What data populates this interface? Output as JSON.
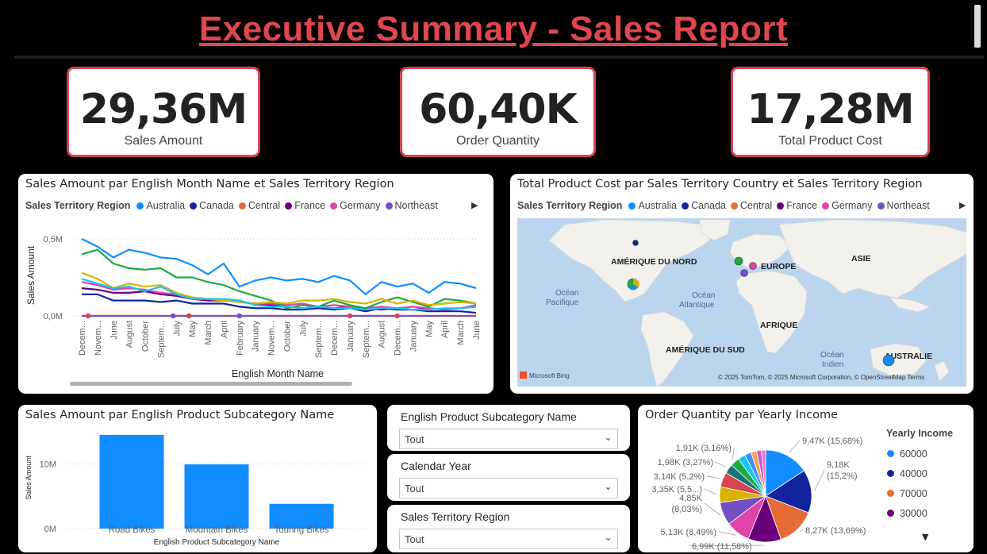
{
  "page": {
    "title": "Executive Summary - Sales Report "
  },
  "kpis": [
    {
      "value": "29,36M",
      "label": "Sales Amount"
    },
    {
      "value": "60,40K",
      "label": "Order Quantity"
    },
    {
      "value": "17,28M",
      "label": "Total Product Cost"
    }
  ],
  "line_panel": {
    "title": "Sales Amount par English Month Name et Sales Territory Region",
    "legend_title": "Sales Territory Region",
    "legend": [
      {
        "name": "Australia",
        "color": "#118dff"
      },
      {
        "name": "Canada",
        "color": "#12239e"
      },
      {
        "name": "Central",
        "color": "#e66c37"
      },
      {
        "name": "France",
        "color": "#6b007b"
      },
      {
        "name": "Germany",
        "color": "#e044a7"
      },
      {
        "name": "Northeast",
        "color": "#744ec2"
      }
    ],
    "legend_more": "▶"
  },
  "map_panel": {
    "title": "Total Product Cost par Sales Territory Country et Sales Territory Region",
    "legend_title": "Sales Territory Region",
    "legend": [
      {
        "name": "Australia",
        "color": "#118dff"
      },
      {
        "name": "Canada",
        "color": "#12239e"
      },
      {
        "name": "Central",
        "color": "#e66c37"
      },
      {
        "name": "France",
        "color": "#6b007b"
      },
      {
        "name": "Germany",
        "color": "#e044a7"
      },
      {
        "name": "Northeast",
        "color": "#744ec2"
      }
    ],
    "legend_more": "▶",
    "labels": {
      "na": "AMÉRIQUE DU NORD",
      "eu": "EUROPE",
      "asia": "ASIE",
      "africa": "AFRIQUE",
      "sa": "AMÉRIQUE DU SUD",
      "aus": "AUSTRALIE",
      "pac1": "Océan",
      "pac2": "Pacifique",
      "atl1": "Océan",
      "atl2": "Atlantique",
      "ind1": "Océan",
      "ind2": "Indien"
    },
    "attribution": "© 2025 TomTom, © 2025 Microsoft Corporation, © OpenStreetMap  Terms",
    "bing": "Microsoft Bing"
  },
  "bar_panel": {
    "title": "Sales Amount par English Product Subcategory Name"
  },
  "slicers": [
    {
      "title": "English Product Subcategory Name",
      "value": "Tout"
    },
    {
      "title": "Calendar Year",
      "value": "Tout"
    },
    {
      "title": "Sales Territory Region",
      "value": "Tout"
    }
  ],
  "pie_panel": {
    "title": "Order Quantity par Yearly Income",
    "legend_title": "Yearly Income",
    "legend": [
      {
        "name": "60000",
        "color": "#118dff"
      },
      {
        "name": "40000",
        "color": "#12239e"
      },
      {
        "name": "70000",
        "color": "#e66c37"
      },
      {
        "name": "30000",
        "color": "#6b007b"
      }
    ],
    "legend_more": "▼"
  },
  "chart_data": [
    {
      "type": "line",
      "xlabel": "English Month Name",
      "ylabel": "Sales Amount",
      "ytick_labels": [
        "0,0M",
        "0,5M"
      ],
      "ylim": [
        0,
        0.5
      ],
      "categories": [
        "Decem...",
        "Novem...",
        "June",
        "August",
        "October",
        "Septem...",
        "July",
        "May",
        "March",
        "April",
        "February",
        "January",
        "Novem...",
        "October",
        "July",
        "Septem...",
        "Decem...",
        "January",
        "Septem...",
        "August",
        "Decem...",
        "January",
        "May",
        "April",
        "March",
        "June"
      ],
      "series": [
        {
          "name": "Australia",
          "color": "#118dff",
          "values": [
            0.5,
            0.45,
            0.38,
            0.43,
            0.41,
            0.38,
            0.37,
            0.33,
            0.27,
            0.34,
            0.19,
            0.23,
            0.25,
            0.23,
            0.24,
            0.22,
            0.26,
            0.23,
            0.14,
            0.22,
            0.19,
            0.21,
            0.15,
            0.22,
            0.21,
            0.18
          ]
        },
        {
          "name": "Canada",
          "color": "#12239e",
          "values": [
            0.14,
            0.14,
            0.1,
            0.1,
            0.1,
            0.09,
            0.1,
            0.08,
            0.08,
            0.08,
            0.06,
            0.05,
            0.05,
            0.04,
            0.04,
            0.05,
            0.04,
            0.05,
            0.03,
            0.05,
            0.04,
            0.04,
            0.03,
            0.03,
            0.03,
            0.02
          ]
        },
        {
          "name": "Central",
          "color": "#e66c37",
          "values": [
            0.0,
            0.0,
            0.0,
            0.0,
            0.0,
            0.0,
            0.0,
            0.0,
            0.0,
            0.0,
            0.0,
            0.0,
            0.0,
            0.0,
            0.0,
            0.0,
            0.0,
            0.0,
            0.0,
            0.0,
            0.0,
            0.0,
            0.0,
            0.0,
            0.0,
            0.0
          ]
        },
        {
          "name": "France",
          "color": "#6b007b",
          "values": [
            0.18,
            0.17,
            0.15,
            0.15,
            0.16,
            0.14,
            0.13,
            0.11,
            0.1,
            0.1,
            0.09,
            0.08,
            0.07,
            0.06,
            0.05,
            0.06,
            0.05,
            0.06,
            0.05,
            0.04,
            0.05,
            0.04,
            0.05,
            0.04,
            0.05,
            0.06
          ]
        },
        {
          "name": "Germany",
          "color": "#e044a7",
          "values": [
            0.22,
            0.2,
            0.17,
            0.18,
            0.17,
            0.15,
            0.14,
            0.12,
            0.11,
            0.1,
            0.09,
            0.08,
            0.08,
            0.07,
            0.08,
            0.06,
            0.07,
            0.06,
            0.05,
            0.06,
            0.05,
            0.06,
            0.05,
            0.04,
            0.05,
            0.07
          ]
        },
        {
          "name": "Northeast",
          "color": "#744ec2",
          "values": [
            0.0,
            0.0,
            0.0,
            0.0,
            0.0,
            0.0,
            0.0,
            0.0,
            0.0,
            0.0,
            0.0,
            0.0,
            0.0,
            0.0,
            0.0,
            0.0,
            0.0,
            0.0,
            0.0,
            0.0,
            0.0,
            0.0,
            0.0,
            0.0,
            0.0,
            0.0
          ]
        },
        {
          "name": "",
          "color": "#1aab40",
          "values": [
            0.4,
            0.43,
            0.34,
            0.31,
            0.3,
            0.31,
            0.25,
            0.25,
            0.22,
            0.2,
            0.16,
            0.13,
            0.1,
            0.05,
            0.07,
            0.06,
            0.1,
            0.07,
            0.05,
            0.09,
            0.12,
            0.09,
            0.06,
            0.11,
            0.1,
            0.08
          ]
        },
        {
          "name": "",
          "color": "#d9b300",
          "values": [
            0.28,
            0.24,
            0.18,
            0.21,
            0.19,
            0.2,
            0.15,
            0.12,
            0.11,
            0.1,
            0.09,
            0.08,
            0.09,
            0.08,
            0.1,
            0.1,
            0.11,
            0.09,
            0.08,
            0.11,
            0.08,
            0.1,
            0.07,
            0.08,
            0.09,
            0.08
          ]
        },
        {
          "name": "",
          "color": "#15c6f4",
          "values": [
            0.24,
            0.21,
            0.18,
            0.19,
            0.16,
            0.19,
            0.14,
            0.11,
            0.11,
            0.11,
            0.1,
            0.07,
            0.06,
            0.06,
            0.05,
            0.06,
            0.05,
            0.05,
            0.04,
            0.05,
            0.05,
            0.04,
            0.04,
            0.05,
            0.05,
            0.06
          ]
        }
      ]
    },
    {
      "type": "bar",
      "xlabel": "English Product Subcategory Name",
      "ylabel": "Sales Amount",
      "ytick_labels": [
        "0M",
        "10M"
      ],
      "categories": [
        "Road Bikes",
        "Mountain Bikes",
        "Touring Bikes"
      ],
      "values": [
        14.52,
        9.95,
        3.84
      ],
      "ylim": [
        0,
        15
      ],
      "color": "#118dff"
    },
    {
      "type": "pie",
      "slices": [
        {
          "value": 9.47,
          "label": "9,47K (15,68%)",
          "color": "#118dff"
        },
        {
          "value": 9.18,
          "label": "9,18K (15,2%)",
          "color": "#12239e"
        },
        {
          "value": 8.27,
          "label": "8,27K (13,69%)",
          "color": "#e66c37"
        },
        {
          "value": 6.99,
          "label": "6,99K (11,58%)",
          "color": "#6b007b"
        },
        {
          "value": 5.13,
          "label": "5,13K (8,49%)",
          "color": "#e044a7"
        },
        {
          "value": 4.85,
          "label": "4,85K (8,03%)",
          "color": "#744ec2"
        },
        {
          "value": 3.35,
          "label": "3,35K (5,5...)",
          "color": "#d9b300"
        },
        {
          "value": 3.14,
          "label": "3,14K (5,2%)",
          "color": "#d64550"
        },
        {
          "value": 1.98,
          "label": "1,98K (3,27%)",
          "color": "#197278"
        },
        {
          "value": 1.91,
          "label": "1,91K (3,16%)",
          "color": "#1aab40"
        },
        {
          "value": 1.6,
          "label": "",
          "color": "#15c6f4"
        },
        {
          "value": 1.4,
          "label": "",
          "color": "#4092ff"
        },
        {
          "value": 1.2,
          "label": "",
          "color": "#ffa058"
        },
        {
          "value": 1.0,
          "label": "",
          "color": "#be5dc9"
        },
        {
          "value": 0.9,
          "label": "",
          "color": "#f472d0"
        }
      ]
    }
  ]
}
